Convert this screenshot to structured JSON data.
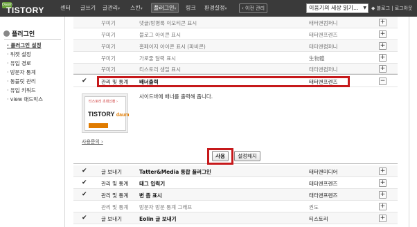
{
  "topbar": {
    "logo_badge": "Daum",
    "logo_text": "TISTORY",
    "nav": [
      {
        "label": "센터",
        "caret": ""
      },
      {
        "label": "글쓰기",
        "caret": ""
      },
      {
        "label": "글관리",
        "caret": "▾"
      },
      {
        "label": "스킨",
        "caret": "▾"
      },
      {
        "label": "플러그인",
        "caret": "▾"
      },
      {
        "label": "링크",
        "caret": ""
      },
      {
        "label": "환경설정",
        "caret": "▾"
      }
    ],
    "prev_admin": "‹ 이전 관리",
    "blog_select": "이웅기의 세상 읽기...",
    "util": "◆ 블로그 | 로그아웃"
  },
  "sidebar": {
    "title": "플러그인",
    "items": [
      "플러그인 설정",
      "위젯 설정",
      "유입 경로",
      "방문자 통계",
      "동블릿 관리",
      "유입 키워드",
      "view 애드박스"
    ]
  },
  "rows_top": [
    {
      "check": "",
      "category": "꾸미기",
      "name": "댓글/방명록 이모티콘 표시",
      "author": "태터앤컴퍼니",
      "toggle": "+"
    },
    {
      "check": "",
      "category": "꾸미기",
      "name": "블로그 아이콘 표시",
      "author": "태터앤프렌즈",
      "toggle": "+"
    },
    {
      "check": "",
      "category": "꾸미기",
      "name": "홈페이지 아이콘 표시 (파비콘)",
      "author": "태터앤컴퍼니",
      "toggle": "+"
    },
    {
      "check": "",
      "category": "꾸미기",
      "name": "가로줄 달력 표시",
      "author": "生物體",
      "toggle": "+"
    },
    {
      "check": "",
      "category": "꾸미기",
      "name": "티스토리 생일 표시",
      "author": "태터앤컴퍼니",
      "toggle": "+"
    }
  ],
  "expanded": {
    "check": "✔",
    "category": "관리 및 통계",
    "name": "배너출력",
    "author": "태터앤프렌즈",
    "toggle": "−",
    "description": "사이드바에 배너를 출력해 줍니다.",
    "thumb_tag": "티스토리 초대신청 ›",
    "thumb_logo": "TISTORY",
    "thumb_logo_sub": "daum",
    "usage_link": "사용문의 ›",
    "btn_use": "사용",
    "btn_off": "설정해지"
  },
  "rows_bottom": [
    {
      "check": "✔",
      "category": "글 보내기",
      "name": "Tatter&Media 통합 플러그인",
      "author": "태터앤미디어",
      "toggle": "+"
    },
    {
      "check": "✔",
      "category": "관리 및 통계",
      "name": "태그 입력기",
      "author": "태터앤프렌즈",
      "toggle": "+"
    },
    {
      "check": "✔",
      "category": "관리 및 통계",
      "name": "변 좀 표시",
      "author": "태터앤프렌즈",
      "toggle": "+"
    },
    {
      "check": "",
      "category": "관리 및 통계",
      "name": "방문자 방문 통계 그래프",
      "author": "권도",
      "toggle": "+"
    },
    {
      "check": "✔",
      "category": "글 보내기",
      "name": "Eolin 글 보내기",
      "author": "티스토리",
      "toggle": "+"
    }
  ]
}
